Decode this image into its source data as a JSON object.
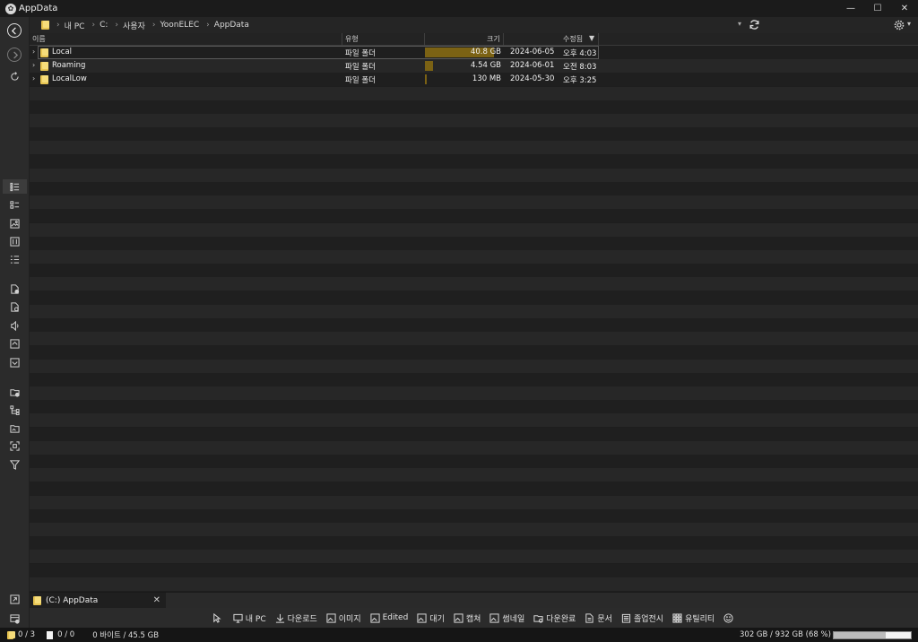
{
  "window": {
    "title": "AppData"
  },
  "address": {
    "crumbs": [
      "내 PC",
      "C:",
      "사용자",
      "YoonELEC",
      "AppData"
    ]
  },
  "columns": {
    "name": "이름",
    "type": "유형",
    "size": "크기",
    "modified": "수정됨"
  },
  "files": [
    {
      "name": "Local",
      "type": "파일 폴더",
      "size": "40.8 GB",
      "date": "2024-06-05",
      "time": "오후 4:03",
      "share": 0.897
    },
    {
      "name": "Roaming",
      "type": "파일 폴더",
      "size": "4.54 GB",
      "date": "2024-06-01",
      "time": "오전 8:03",
      "share": 0.1
    },
    {
      "name": "LocalLow",
      "type": "파일 폴더",
      "size": "130 MB",
      "date": "2024-05-30",
      "time": "오후 3:25",
      "share": 0.003
    }
  ],
  "tab": {
    "label": "(C:) AppData"
  },
  "bottom_bar": {
    "my_pc": "내 PC",
    "downloads": "다운로드",
    "images": "이미지",
    "edited": "Edited",
    "queue": "대기",
    "capture": "캡쳐",
    "thumbnail": "썸네일",
    "download_done": "다운완료",
    "documents": "문서",
    "graduation": "졸업전시",
    "utility": "유틸리티"
  },
  "status": {
    "folders": "0 / 3",
    "files": "0 / 0",
    "bytes": "0 바이트 / 45.5 GB",
    "disk": "302 GB / 932 GB  (68 %)",
    "disk_used_fraction": 0.68
  },
  "colors": {
    "accent_bar": "#7b6214",
    "folder": "#e7c451"
  }
}
